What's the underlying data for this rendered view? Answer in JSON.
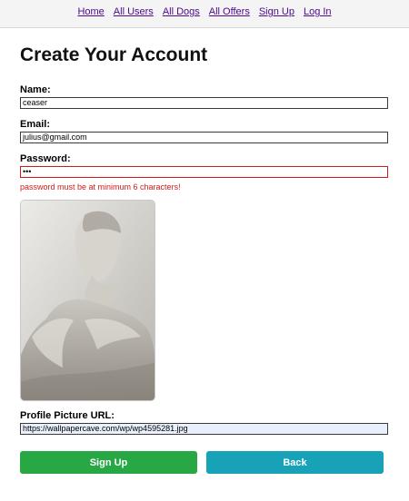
{
  "nav": {
    "items": [
      {
        "label": "Home"
      },
      {
        "label": "All Users"
      },
      {
        "label": "All Dogs"
      },
      {
        "label": "All Offers"
      },
      {
        "label": "Sign Up"
      },
      {
        "label": "Log In"
      }
    ]
  },
  "page": {
    "title": "Create Your Account"
  },
  "form": {
    "name": {
      "label": "Name:",
      "value": "ceaser"
    },
    "email": {
      "label": "Email:",
      "value": "julius@gmail.com"
    },
    "password": {
      "label": "Password:",
      "value": "•••",
      "error": "password must be at minimum 6 characters!"
    },
    "profile_picture": {
      "label": "Profile Picture URL:",
      "value": "https://wallpapercave.com/wp/wp4595281.jpg"
    }
  },
  "actions": {
    "sign_up_label": "Sign Up",
    "back_label": "Back"
  },
  "colors": {
    "primary": "#28a745",
    "secondary": "#17a2b8",
    "error": "#d11a1a",
    "link": "#4b0a8a"
  },
  "icons": {
    "profile_image": "statue-photo"
  }
}
